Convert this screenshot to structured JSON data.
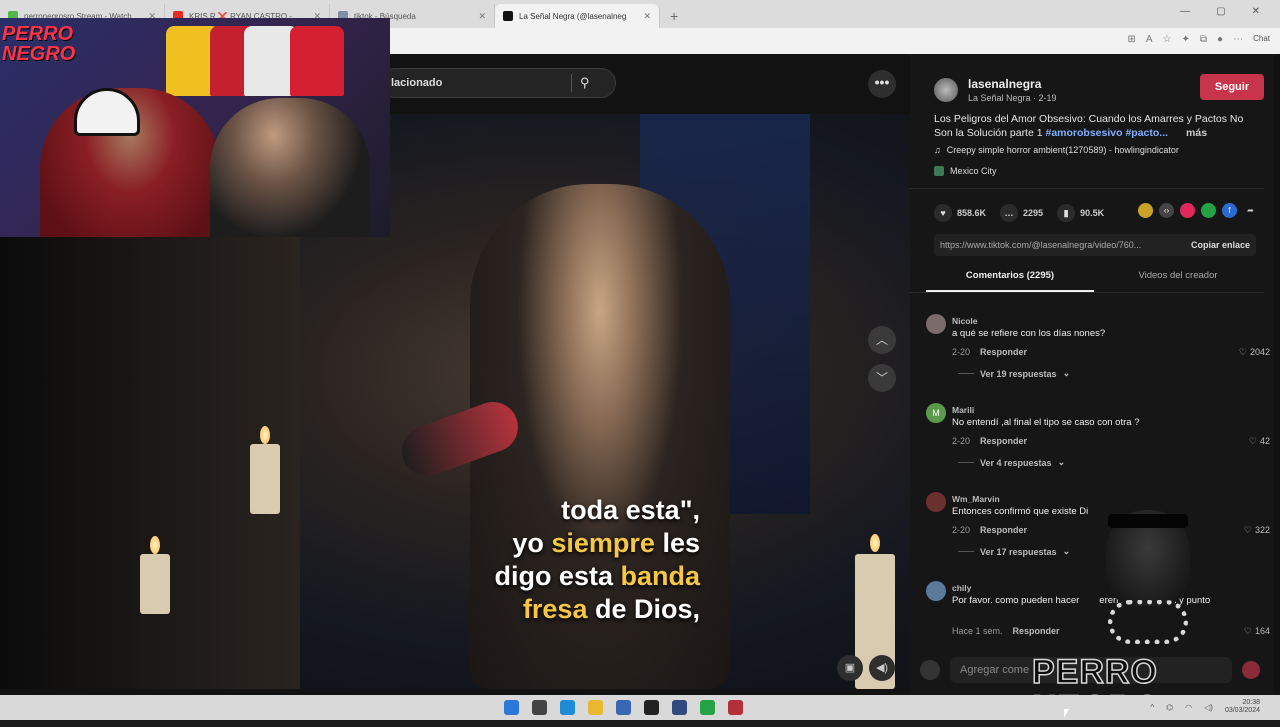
{
  "browser": {
    "tabs": [
      {
        "title": "perronegrosro Stream - Watch Live",
        "color": "#53b54a",
        "active": false
      },
      {
        "title": "KRIS R ❌ RYAN CASTRO - MAS C",
        "color": "#e52d27",
        "active": false
      },
      {
        "title": "tiktok - Búsqueda",
        "color": "#7f8fa8",
        "active": false
      },
      {
        "title": "La Señal Negra (@lasenalneg",
        "color": "#111111",
        "active": true
      }
    ],
    "new_tab": "+",
    "chat_label": "Chat"
  },
  "webcam": {
    "logo_line1": "PERRO",
    "logo_line2": "NEGRO"
  },
  "search": {
    "value": "lacionado"
  },
  "video": {
    "subtitle_parts": [
      "toda esta\",",
      "yo ",
      "siempre",
      " les",
      "digo esta ",
      "banda",
      "fresa",
      " de Dios,"
    ]
  },
  "post": {
    "username": "lasenalnegra",
    "display_name": "La Señal Negra · 2-19",
    "follow_label": "Seguir",
    "description": "Los Peligros del Amor Obsesivo: Cuando los Amarres y Pactos No Son la Solución parte 1 ",
    "hashtags": "#amorobsesivo #pacto...",
    "more_label": "más",
    "music": "Creepy simple horror ambient(1270589) - howlingindicator",
    "location": "Mexico City",
    "likes": "858.6K",
    "comments_count": "2295",
    "saves": "90.5K",
    "url": "https://www.tiktok.com/@lasenalnegra/video/760...",
    "copy_label": "Copiar enlace",
    "tab_comments": "Comentarios (2295)",
    "tab_creator": "Videos del creador"
  },
  "comments": [
    {
      "name": "Nicole",
      "text": "a qué se refiere con los días nones?",
      "date": "2-20",
      "reply": "Responder",
      "likes": "2042",
      "replies": "Ver 19 respuestas",
      "avatar_color": "#7a6a6a"
    },
    {
      "name": "Marili",
      "text": "No entendí ,al final el tipo se caso con otra ?",
      "date": "2-20",
      "reply": "Responder",
      "likes": "42",
      "replies": "Ver 4 respuestas",
      "avatar_color": "#5a9a4a"
    },
    {
      "name": "Wm_Marvin",
      "text": "Entonces confirmó que existe Di",
      "date": "2-20",
      "reply": "Responder",
      "likes": "322",
      "replies": "Ver 17 respuestas",
      "avatar_color": "#6a3030"
    },
    {
      "name": "chily",
      "text": "Por favor. como pueden hacer",
      "text2": "eren no te quieren y punto",
      "date": "Hace 1 sem.",
      "reply": "Responder",
      "likes": "164",
      "replies": "",
      "avatar_color": "#5a7a9a"
    }
  ],
  "add_comment": {
    "placeholder": "Agregar come"
  },
  "overlay": {
    "brand": "PERRO NEGRO"
  },
  "taskbar": {
    "time": "20:38",
    "date": "03/03/2024"
  },
  "icons": {
    "like": "♥",
    "comment": "…",
    "save": "▮",
    "search": "⚲",
    "up": "︿",
    "down": "﹀",
    "more": "•••",
    "music": "♫",
    "share": "➦"
  }
}
